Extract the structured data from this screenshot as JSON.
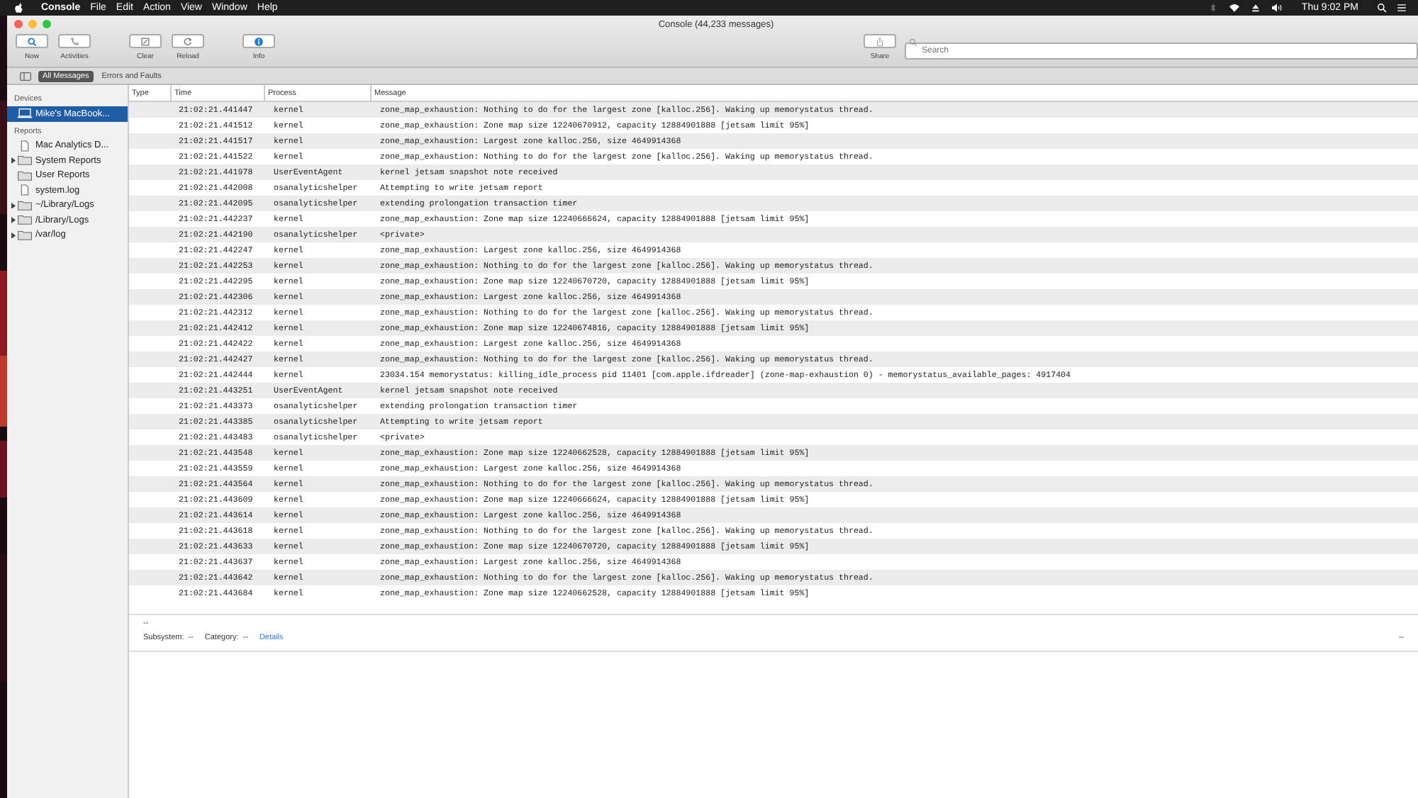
{
  "menu_bar": {
    "app_name": "Console",
    "items": [
      "File",
      "Edit",
      "Action",
      "View",
      "Window",
      "Help"
    ],
    "clock": "Thu 9:02 PM"
  },
  "window": {
    "title": "Console (44,233 messages)"
  },
  "toolbar": {
    "buttons": [
      {
        "label": "Now",
        "kind": "now"
      },
      {
        "label": "Activities",
        "kind": "activities"
      },
      {
        "label": "Clear",
        "kind": "clear"
      },
      {
        "label": "Reload",
        "kind": "reload"
      },
      {
        "label": "Info",
        "kind": "info"
      }
    ],
    "share": {
      "label": "Share"
    },
    "search": {
      "placeholder": "Search"
    }
  },
  "scope_tabs": [
    {
      "label": "All Messages",
      "selected": true
    },
    {
      "label": "Errors and Faults",
      "selected": false
    }
  ],
  "sidebar": {
    "sections": [
      {
        "title": "Devices",
        "items": [
          {
            "label": "Mike's MacBook...",
            "kind": "laptop",
            "disclosure": false,
            "selected": true
          }
        ]
      },
      {
        "title": "Reports",
        "items": [
          {
            "label": "Mac Analytics D...",
            "kind": "document",
            "disclosure": false,
            "selected": false
          },
          {
            "label": "System Reports",
            "kind": "folder",
            "disclosure": true,
            "selected": false
          },
          {
            "label": "User Reports",
            "kind": "folder",
            "disclosure": false,
            "selected": false
          },
          {
            "label": "system.log",
            "kind": "document",
            "disclosure": false,
            "selected": false
          },
          {
            "label": "~/Library/Logs",
            "kind": "folder",
            "disclosure": true,
            "selected": false
          },
          {
            "label": "/Library/Logs",
            "kind": "folder",
            "disclosure": true,
            "selected": false
          },
          {
            "label": "/var/log",
            "kind": "folder",
            "disclosure": true,
            "selected": false
          }
        ]
      }
    ]
  },
  "table": {
    "columns": [
      "Type",
      "Time",
      "Process",
      "Message"
    ],
    "rows": [
      {
        "time": "21:02:21.441447",
        "process": "kernel",
        "message": "zone_map_exhaustion: Nothing to do for the largest zone [kalloc.256]. Waking up memorystatus thread."
      },
      {
        "time": "21:02:21.441512",
        "process": "kernel",
        "message": "zone_map_exhaustion: Zone map size 12240670912, capacity 12884901888 [jetsam limit 95%]"
      },
      {
        "time": "21:02:21.441517",
        "process": "kernel",
        "message": "zone_map_exhaustion: Largest zone kalloc.256, size 4649914368"
      },
      {
        "time": "21:02:21.441522",
        "process": "kernel",
        "message": "zone_map_exhaustion: Nothing to do for the largest zone [kalloc.256]. Waking up memorystatus thread."
      },
      {
        "time": "21:02:21.441978",
        "process": "UserEventAgent",
        "message": "kernel jetsam snapshot note received"
      },
      {
        "time": "21:02:21.442008",
        "process": "osanalyticshelper",
        "message": "Attempting to write jetsam report"
      },
      {
        "time": "21:02:21.442095",
        "process": "osanalyticshelper",
        "message": "extending prolongation transaction timer"
      },
      {
        "time": "21:02:21.442237",
        "process": "kernel",
        "message": "zone_map_exhaustion: Zone map size 12240666624, capacity 12884901888 [jetsam limit 95%]"
      },
      {
        "time": "21:02:21.442190",
        "process": "osanalyticshelper",
        "message": "<private>"
      },
      {
        "time": "21:02:21.442247",
        "process": "kernel",
        "message": "zone_map_exhaustion: Largest zone kalloc.256, size 4649914368"
      },
      {
        "time": "21:02:21.442253",
        "process": "kernel",
        "message": "zone_map_exhaustion: Nothing to do for the largest zone [kalloc.256]. Waking up memorystatus thread."
      },
      {
        "time": "21:02:21.442295",
        "process": "kernel",
        "message": "zone_map_exhaustion: Zone map size 12240670720, capacity 12884901888 [jetsam limit 95%]"
      },
      {
        "time": "21:02:21.442306",
        "process": "kernel",
        "message": "zone_map_exhaustion: Largest zone kalloc.256, size 4649914368"
      },
      {
        "time": "21:02:21.442312",
        "process": "kernel",
        "message": "zone_map_exhaustion: Nothing to do for the largest zone [kalloc.256]. Waking up memorystatus thread."
      },
      {
        "time": "21:02:21.442412",
        "process": "kernel",
        "message": "zone_map_exhaustion: Zone map size 12240674816, capacity 12884901888 [jetsam limit 95%]"
      },
      {
        "time": "21:02:21.442422",
        "process": "kernel",
        "message": "zone_map_exhaustion: Largest zone kalloc.256, size 4649914368"
      },
      {
        "time": "21:02:21.442427",
        "process": "kernel",
        "message": "zone_map_exhaustion: Nothing to do for the largest zone [kalloc.256]. Waking up memorystatus thread."
      },
      {
        "time": "21:02:21.442444",
        "process": "kernel",
        "message": "23034.154 memorystatus: killing_idle_process pid 11401 [com.apple.ifdreader] (zone-map-exhaustion 0) - memorystatus_available_pages: 4917404"
      },
      {
        "time": "21:02:21.443251",
        "process": "UserEventAgent",
        "message": "kernel jetsam snapshot note received"
      },
      {
        "time": "21:02:21.443373",
        "process": "osanalyticshelper",
        "message": "extending prolongation transaction timer"
      },
      {
        "time": "21:02:21.443385",
        "process": "osanalyticshelper",
        "message": "Attempting to write jetsam report"
      },
      {
        "time": "21:02:21.443483",
        "process": "osanalyticshelper",
        "message": "<private>"
      },
      {
        "time": "21:02:21.443548",
        "process": "kernel",
        "message": "zone_map_exhaustion: Zone map size 12240662528, capacity 12884901888 [jetsam limit 95%]"
      },
      {
        "time": "21:02:21.443559",
        "process": "kernel",
        "message": "zone_map_exhaustion: Largest zone kalloc.256, size 4649914368"
      },
      {
        "time": "21:02:21.443564",
        "process": "kernel",
        "message": "zone_map_exhaustion: Nothing to do for the largest zone [kalloc.256]. Waking up memorystatus thread."
      },
      {
        "time": "21:02:21.443609",
        "process": "kernel",
        "message": "zone_map_exhaustion: Zone map size 12240666624, capacity 12884901888 [jetsam limit 95%]"
      },
      {
        "time": "21:02:21.443614",
        "process": "kernel",
        "message": "zone_map_exhaustion: Largest zone kalloc.256, size 4649914368"
      },
      {
        "time": "21:02:21.443618",
        "process": "kernel",
        "message": "zone_map_exhaustion: Nothing to do for the largest zone [kalloc.256]. Waking up memorystatus thread."
      },
      {
        "time": "21:02:21.443633",
        "process": "kernel",
        "message": "zone_map_exhaustion: Zone map size 12240670720, capacity 12884901888 [jetsam limit 95%]"
      },
      {
        "time": "21:02:21.443637",
        "process": "kernel",
        "message": "zone_map_exhaustion: Largest zone kalloc.256, size 4649914368"
      },
      {
        "time": "21:02:21.443642",
        "process": "kernel",
        "message": "zone_map_exhaustion: Nothing to do for the largest zone [kalloc.256]. Waking up memorystatus thread."
      },
      {
        "time": "21:02:21.443684",
        "process": "kernel",
        "message": "zone_map_exhaustion: Zone map size 12240662528, capacity 12884901888 [jetsam limit 95%]"
      }
    ]
  },
  "detail": {
    "message": "--",
    "subsystem_label": "Subsystem:",
    "subsystem": "--",
    "category_label": "Category:",
    "category": "--",
    "link": "Details",
    "right": "--"
  }
}
